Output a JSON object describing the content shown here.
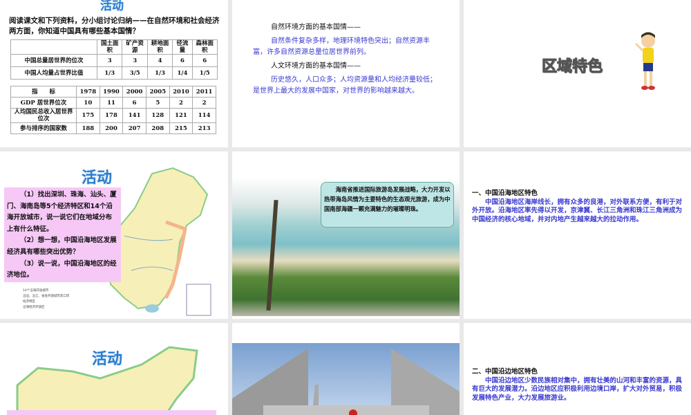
{
  "slide1": {
    "title": "活动",
    "intro": "阅读课文和下列资料，分小组讨论归纳——在自然环境和社会经济两方面，你知道中国具有哪些基本国情？",
    "table1": {
      "headers": [
        "",
        "国土面积",
        "矿产资源",
        "耕地面积",
        "径流量",
        "森林面积"
      ],
      "rows": [
        [
          "中国总量居世界的位次",
          "3",
          "3",
          "4",
          "6",
          "6"
        ],
        [
          "中国人均量占世界比值",
          "1/3",
          "3/5",
          "1/3",
          "1/4",
          "1/5"
        ]
      ]
    },
    "table2": {
      "headers": [
        "指　　标",
        "1978",
        "1990",
        "2000",
        "2005",
        "2010",
        "2011"
      ],
      "rows": [
        [
          "GDP 居世界位次",
          "10",
          "11",
          "6",
          "5",
          "2",
          "2"
        ],
        [
          "人均国民总收入居世界位次",
          "175",
          "178",
          "141",
          "128",
          "121",
          "114"
        ],
        [
          "参与排序的国家数",
          "188",
          "200",
          "207",
          "208",
          "215",
          "213"
        ]
      ]
    }
  },
  "slide2": {
    "h1": "自然环境方面的基本国情——",
    "p1": "自然条件复杂多样，地理环境特色突出；自然资源丰富，许多自然资源总量位居世界前列。",
    "h2": "人文环境方面的基本国情——",
    "p2": "历史悠久，人口众多；人均资源量和人均经济量较低；是世界上最大的发展中国家，对世界的影响越来越大。"
  },
  "slide3": {
    "title": "区域特色"
  },
  "slide4": {
    "title": "活动",
    "q1": "（1）找出深圳、珠海、汕头、厦门、海南岛等5个经济特区和14个沿海开放城市，说一说它们在地域分布上有什么特征。",
    "q2": "（2）想一想，中国沿海地区发展经济具有哪些突出优势？",
    "q3": "（3）说一说，中国沿海地区的经济地位。",
    "legend": [
      "14个沿海开放城市",
      "沿边、沿江、省会开放城市及口岸",
      "经济特区",
      "沿海经济开放区"
    ]
  },
  "slide5": {
    "bubble": "海南省推进国际旅游岛发展战略，大力开发以热带海岛风情为主要特色的生态观光旅游，成为中国南部海疆一颗充满魅力的璀璨明珠。"
  },
  "slide6": {
    "heading": "一、中国沿海地区特色",
    "body": "中国沿海地区海岸线长，拥有众多的良港，对外联系方便，有利于对外开放。沿海地区率先得以开发，京津冀、长江三角洲和珠江三角洲成为中国经济的核心地域，并对内地产生越来越大的拉动作用。"
  },
  "slide7": {
    "title": "活动"
  },
  "slide9": {
    "heading": "二、中国沿边地区特色",
    "body": "中国沿边地区少数民族相对集中，拥有壮美的山河和丰富的资源，具有巨大的发展潜力。沿边地区应积极利用边境口岸，扩大对外贸易，积极发展特色产业，大力发展旅游业。"
  }
}
